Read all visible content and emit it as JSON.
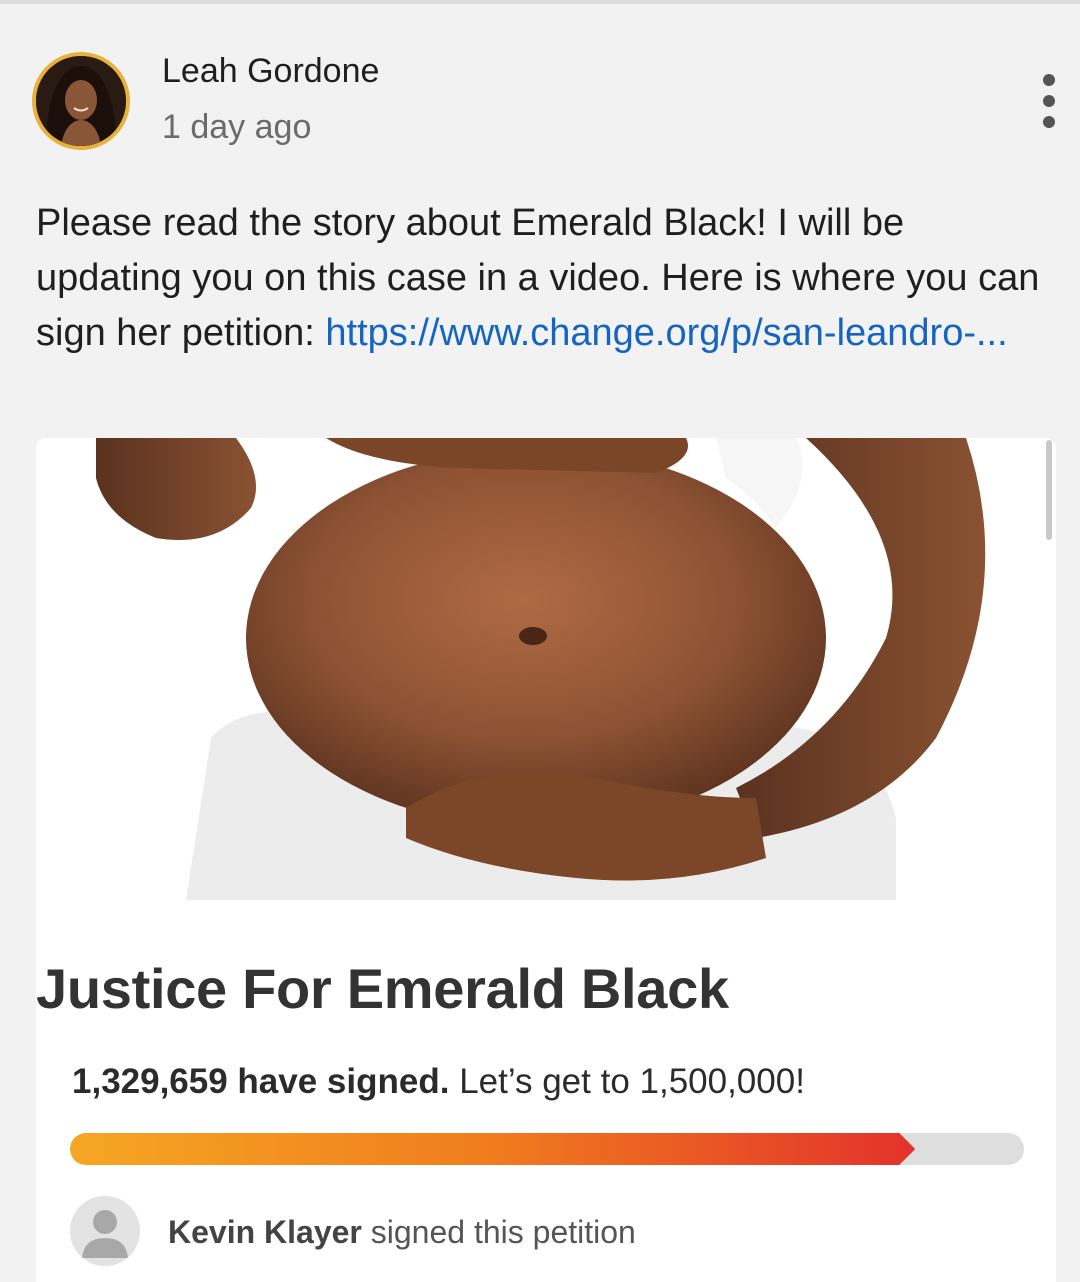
{
  "post": {
    "author": "Leah Gordone",
    "time": "1 day ago",
    "text_before_link": "Please read the story about Emerald Black! I will be updating you on this case in a video. Here is where you can sign her petition: ",
    "link_text": "https://www.change.org/p/san-leandro-...",
    "more_icon": "more-vertical-icon"
  },
  "petition": {
    "title": "Justice For Emerald Black",
    "signed_count": "1,329,659 have signed.",
    "goal_text": "Let’s get to 1,500,000!",
    "progress_fraction": 0.886,
    "progress_colors": [
      "#f5a623",
      "#f07c1e",
      "#e3322b"
    ],
    "recent_signer": {
      "name": "Kevin Klayer",
      "action": " signed this petition",
      "avatar_icon": "default-user-icon"
    }
  },
  "colors": {
    "link": "#1565c0",
    "avatar_ring": "#e8b23a"
  }
}
